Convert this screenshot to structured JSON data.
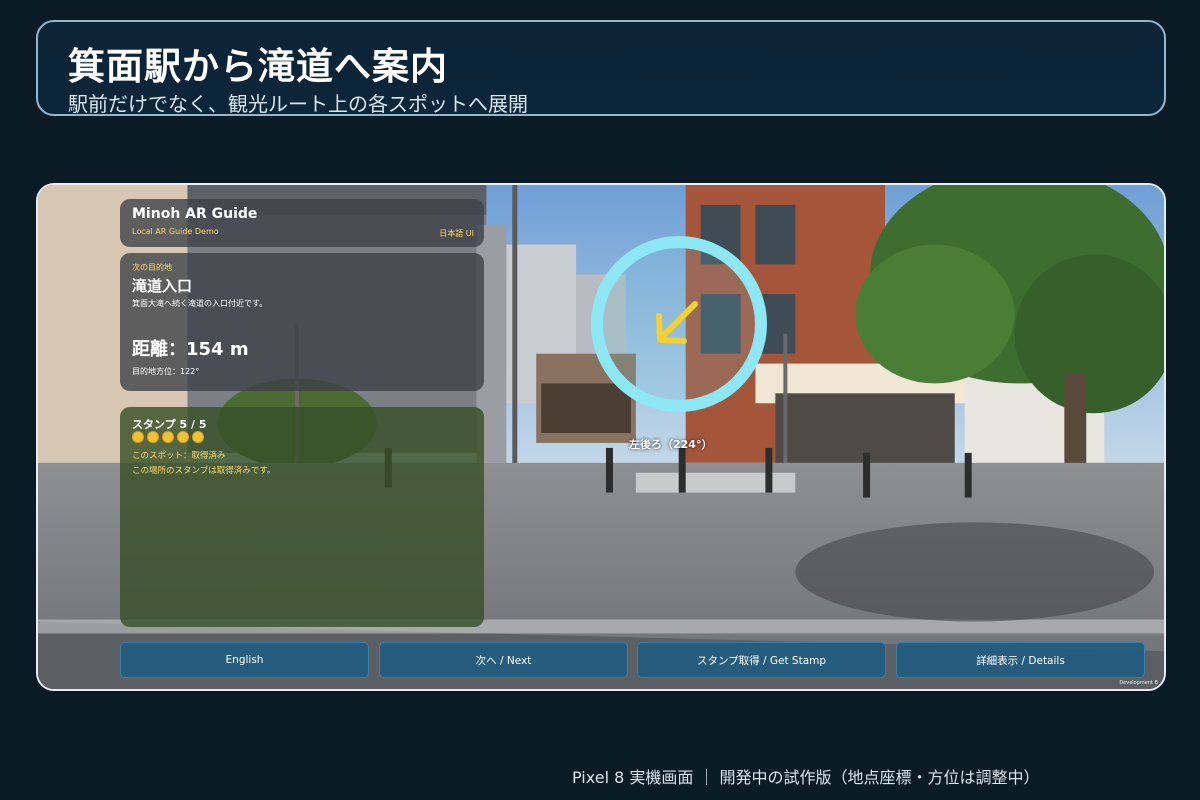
{
  "slide": {
    "title": "箕面駅から滝道へ案内",
    "subtitle": "駅前だけでなく、観光ルート上の各スポットへ展開",
    "caption": "Pixel 8 実機画面 ｜ 開発中の試作版（地点座標・方位は調整中）"
  },
  "app": {
    "title": "Minoh AR Guide",
    "subtitle": "Local AR Guide Demo",
    "language_ui": "日本語 UI"
  },
  "destination": {
    "section_label": "次の目的地",
    "name": "滝道入口",
    "description": "箕面大滝へ続く滝道の入口付近です。",
    "distance": "距離：154 m",
    "bearing": "目的地方位：122°"
  },
  "stamps": {
    "title": "スタンプ 5 / 5",
    "collected": 5,
    "total": 5,
    "spot_status": "このスポット：取得済み",
    "message": "この場所のスタンプは取得済みです。"
  },
  "ar_overlay": {
    "direction_label": "左後ろ（224°）",
    "arrow_icon": "arrow-down-left-icon",
    "ring_color": "#8ee7f4",
    "arrow_color": "#f2d230"
  },
  "buttons": {
    "english": "English",
    "next": "次へ / Next",
    "stamp": "スタンプ取得 / Get Stamp",
    "details": "詳細表示 / Details"
  },
  "watermark": "Development B",
  "colors": {
    "background": "#0b1b25",
    "button": "#225c80",
    "accent_yellow": "#ffd966",
    "stamp_dot": "#f2c233"
  }
}
